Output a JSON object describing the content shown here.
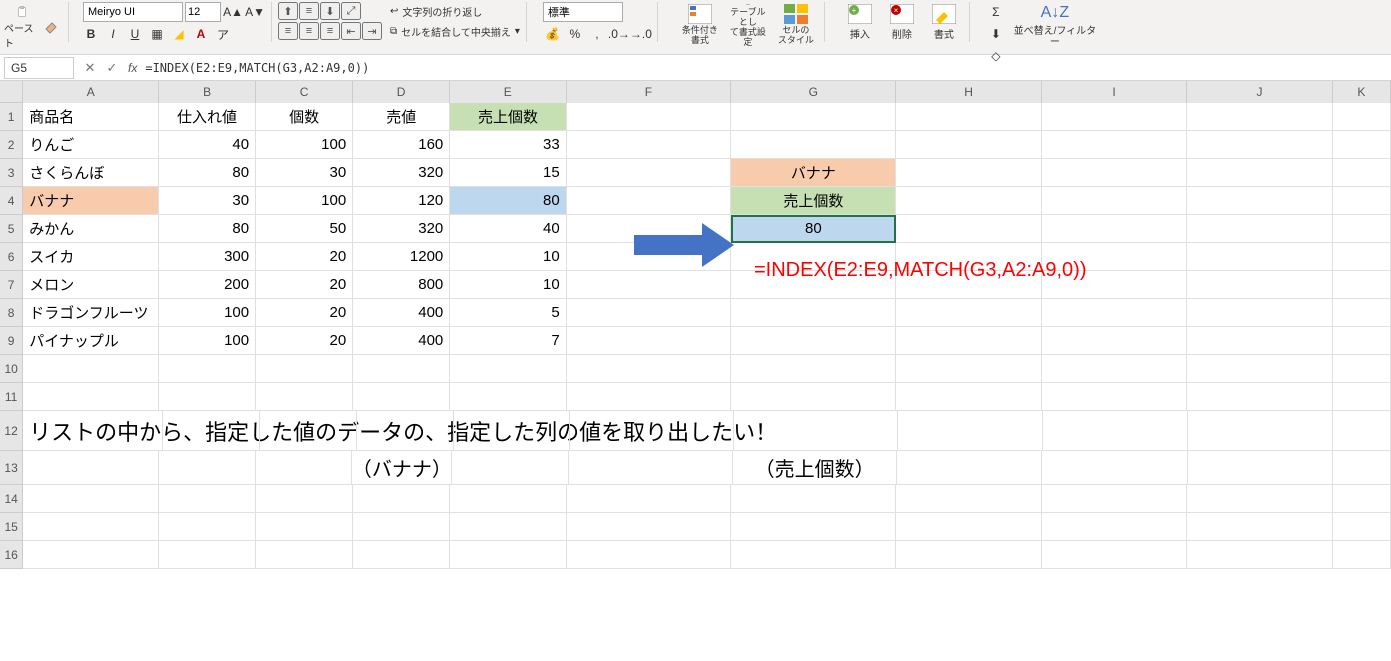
{
  "ribbon": {
    "paste_label": "ペースト",
    "font_name": "Meiryo UI",
    "font_size": "12",
    "wrap_label": "文字列の折り返し",
    "merge_label": "セルを結合して中央揃え",
    "number_format": "標準",
    "cond_fmt_l1": "条件付き",
    "cond_fmt_l2": "書式",
    "table_fmt_l1": "テーブルとし",
    "table_fmt_l2": "て書式設定",
    "cell_style_l1": "セルの",
    "cell_style_l2": "スタイル",
    "insert_label": "挿入",
    "delete_label": "削除",
    "format_label": "書式",
    "sort_label": "並べ替え/フィルター"
  },
  "formula_bar": {
    "cell_ref": "G5",
    "formula": "=INDEX(E2:E9,MATCH(G3,A2:A9,0))"
  },
  "columns": [
    "A",
    "B",
    "C",
    "D",
    "E",
    "F",
    "G",
    "H",
    "I",
    "J",
    "K"
  ],
  "headers": {
    "A": "商品名",
    "B": "仕入れ値",
    "C": "個数",
    "D": "売値",
    "E": "売上個数"
  },
  "rows": [
    {
      "A": "りんご",
      "B": "40",
      "C": "100",
      "D": "160",
      "E": "33"
    },
    {
      "A": "さくらんぼ",
      "B": "80",
      "C": "30",
      "D": "320",
      "E": "15"
    },
    {
      "A": "バナナ",
      "B": "30",
      "C": "100",
      "D": "120",
      "E": "80"
    },
    {
      "A": "みかん",
      "B": "80",
      "C": "50",
      "D": "320",
      "E": "40"
    },
    {
      "A": "スイカ",
      "B": "300",
      "C": "20",
      "D": "1200",
      "E": "10"
    },
    {
      "A": "メロン",
      "B": "200",
      "C": "20",
      "D": "800",
      "E": "10"
    },
    {
      "A": "ドラゴンフルーツ",
      "B": "100",
      "C": "20",
      "D": "400",
      "E": "5"
    },
    {
      "A": "パイナップル",
      "B": "100",
      "C": "20",
      "D": "400",
      "E": "7"
    }
  ],
  "lookup_box": {
    "G3": "バナナ",
    "G4": "売上個数",
    "G5": "80"
  },
  "overlay_formula": "=INDEX(E2:E9,MATCH(G3,A2:A9,0))",
  "explanation": {
    "main": "リストの中から、指定した値のデータの、指定した列の値を取り出したい！",
    "sub1": "（バナナ）",
    "sub2": "（売上個数）"
  },
  "row_numbers": [
    "1",
    "2",
    "3",
    "4",
    "5",
    "6",
    "7",
    "8",
    "9",
    "10",
    "11",
    "12",
    "13",
    "14",
    "15",
    "16"
  ],
  "chart_data": {
    "type": "table",
    "title": "INDEX + MATCH lookup example",
    "columns": [
      "商品名",
      "仕入れ値",
      "個数",
      "売値",
      "売上個数"
    ],
    "data": [
      [
        "りんご",
        40,
        100,
        160,
        33
      ],
      [
        "さくらんぼ",
        80,
        30,
        320,
        15
      ],
      [
        "バナナ",
        30,
        100,
        120,
        80
      ],
      [
        "みかん",
        80,
        50,
        320,
        40
      ],
      [
        "スイカ",
        300,
        20,
        1200,
        10
      ],
      [
        "メロン",
        200,
        20,
        800,
        10
      ],
      [
        "ドラゴンフルーツ",
        100,
        20,
        400,
        5
      ],
      [
        "パイナップル",
        100,
        20,
        400,
        7
      ]
    ],
    "lookup": {
      "key": "バナナ",
      "column": "売上個数",
      "result": 80
    },
    "formula": "=INDEX(E2:E9,MATCH(G3,A2:A9,0))"
  }
}
